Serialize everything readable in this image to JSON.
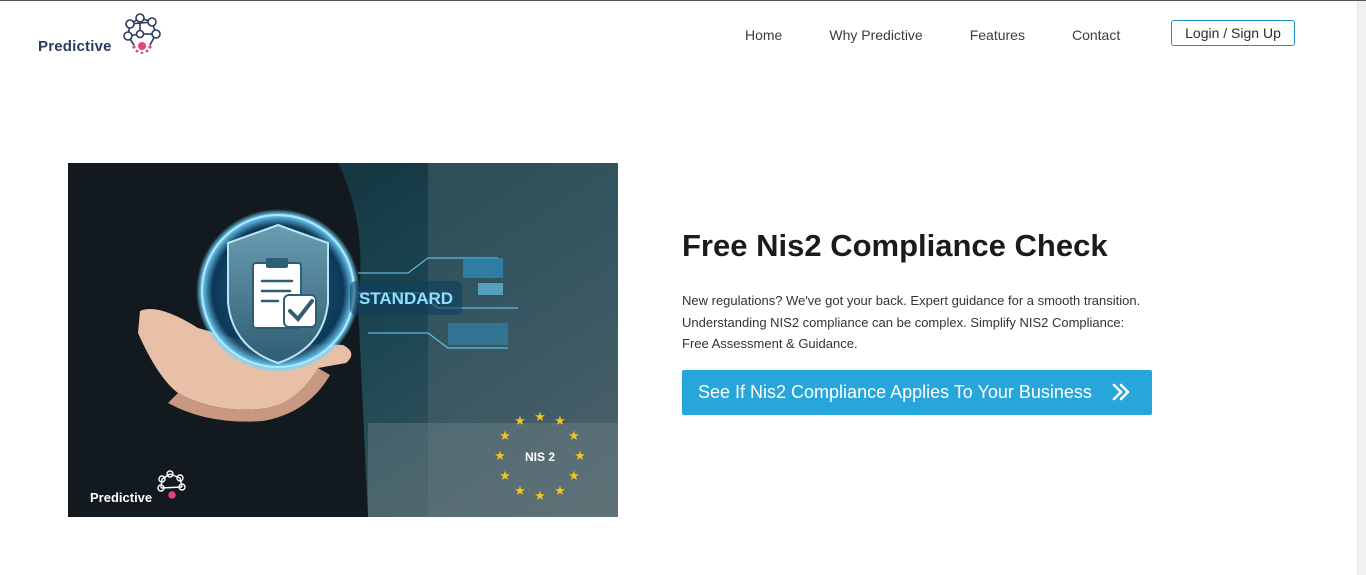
{
  "brand": {
    "name": "Predictive"
  },
  "nav": {
    "items": [
      {
        "label": "Home"
      },
      {
        "label": "Why Predictive"
      },
      {
        "label": "Features"
      },
      {
        "label": "Contact"
      }
    ],
    "login_label": "Login / Sign Up"
  },
  "hero": {
    "image": {
      "badge_text": "STANDARD",
      "eu_badge_text": "NIS 2",
      "watermark_brand": "Predictive"
    },
    "title": "Free Nis2 Compliance Check",
    "description": "New regulations? We've got your back. Expert guidance for a smooth transition. Understanding NIS2 compliance can be complex. Simplify NIS2 Compliance: Free Assessment & Guidance.",
    "cta_label": "See If Nis2 Compliance Applies To Your Business"
  },
  "colors": {
    "accent": "#27a6dc",
    "login_border": "#1f8fc7",
    "logo_text": "#2a3a5c",
    "logo_pink": "#e0457b"
  }
}
